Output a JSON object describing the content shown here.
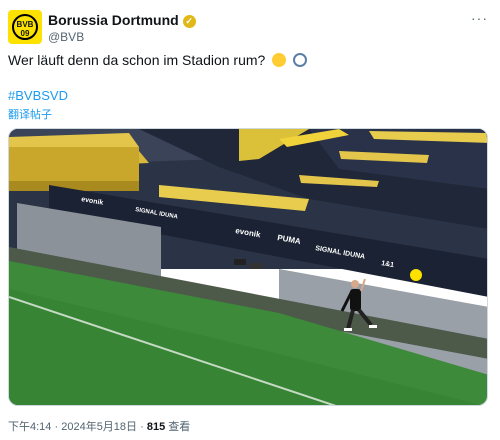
{
  "account": {
    "name": "Borussia Dortmund",
    "handle": "@BVB",
    "avatar_text": "BVB 09",
    "verified_color": "#e2b719",
    "avatar_color": "#fde100"
  },
  "more_icon": "more-icon",
  "tweet": {
    "text": "Wer läuft denn da schon im Stadion rum?",
    "emojis": [
      "monocle-face-emoji",
      "magnifying-glass-emoji"
    ],
    "hashtag": "#BVBSVD",
    "translate_label": "翻译帖子"
  },
  "photo": {
    "ad_boards": [
      "evonik",
      "SIGNAL IDUNA",
      "PUMA",
      "evonik",
      "SIGNAL IDUNA",
      "1&1"
    ]
  },
  "meta": {
    "time": "下午4:14",
    "separator": "·",
    "date": "2024年5月18日",
    "views_count": "815",
    "views_label": "查看"
  }
}
